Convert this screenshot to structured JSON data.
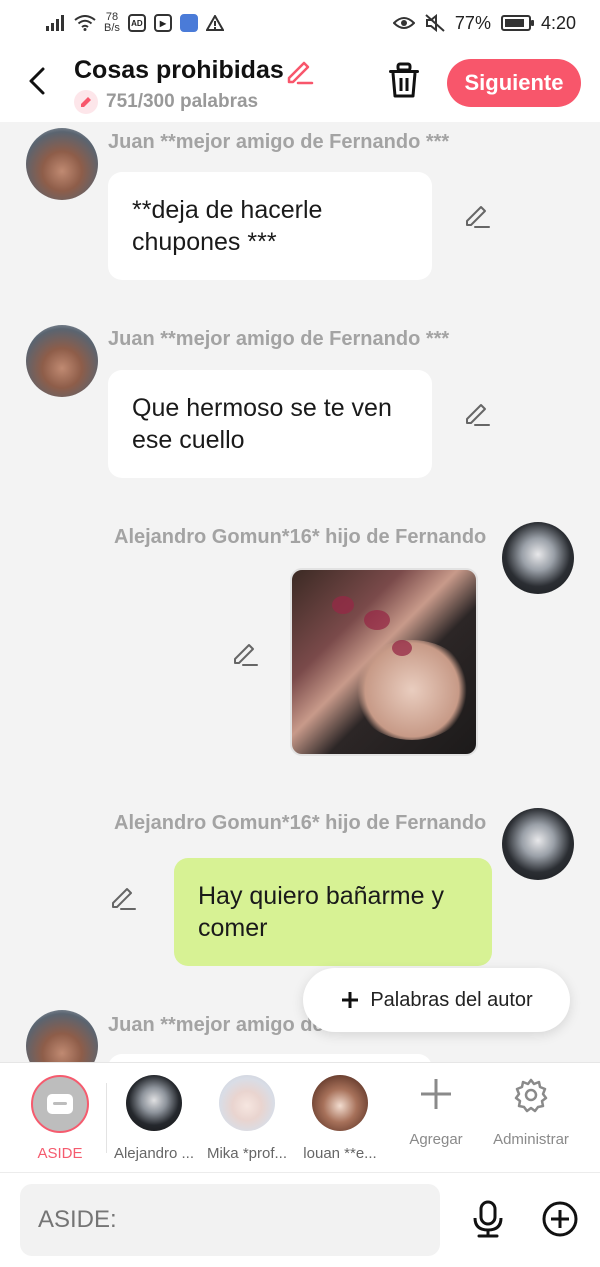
{
  "status_bar": {
    "net_speed_value": "78",
    "net_speed_unit": "B/s",
    "battery": "77%",
    "time": "4:20",
    "app_badges": [
      "AD",
      "▶",
      ""
    ]
  },
  "header": {
    "title": "Cosas prohibidas",
    "word_count": "751/300 palabras",
    "next_label": "Siguiente"
  },
  "messages": [
    {
      "sender": "Juan **mejor amigo de Fernando ***",
      "text": "**deja de hacerle chupones ***"
    },
    {
      "sender": "Juan **mejor amigo de Fernando ***",
      "text": "Que hermoso se te ven ese cuello"
    },
    {
      "sender": "Alejandro Gomun*16* hijo de Fernando"
    },
    {
      "sender": "Alejandro Gomun*16* hijo de Fernando",
      "text": "Hay quiero bañarme y comer"
    },
    {
      "sender": "Juan **mejor amigo de Fernando ***"
    }
  ],
  "author_words_label": "Palabras del autor",
  "characters": [
    {
      "label": "ASIDE"
    },
    {
      "label": "Alejandro ..."
    },
    {
      "label": "Mika *prof..."
    },
    {
      "label": "louan **e..."
    }
  ],
  "tools": {
    "add_label": "Agregar",
    "manage_label": "Administrar"
  },
  "input": {
    "placeholder": "ASIDE:"
  },
  "colors": {
    "accent": "#f8566b",
    "bubble_green": "#d7f294",
    "background": "#f3f3f3"
  }
}
